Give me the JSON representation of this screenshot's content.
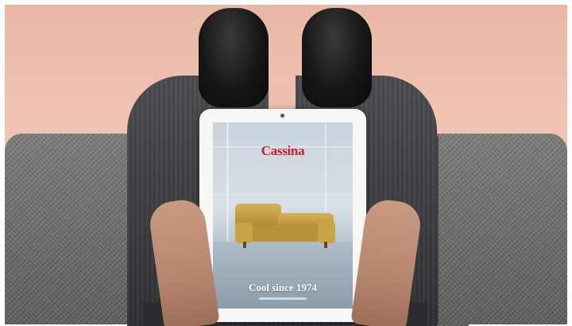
{
  "tablet_cover": {
    "brand": "Cassina",
    "headline": "Cool since 1974"
  },
  "colors": {
    "brand_red": "#c8202a",
    "wall_pink": "#efc0b0",
    "sofa_grey": "#6e6d6c",
    "sofa_mustard": "#c4a042"
  }
}
